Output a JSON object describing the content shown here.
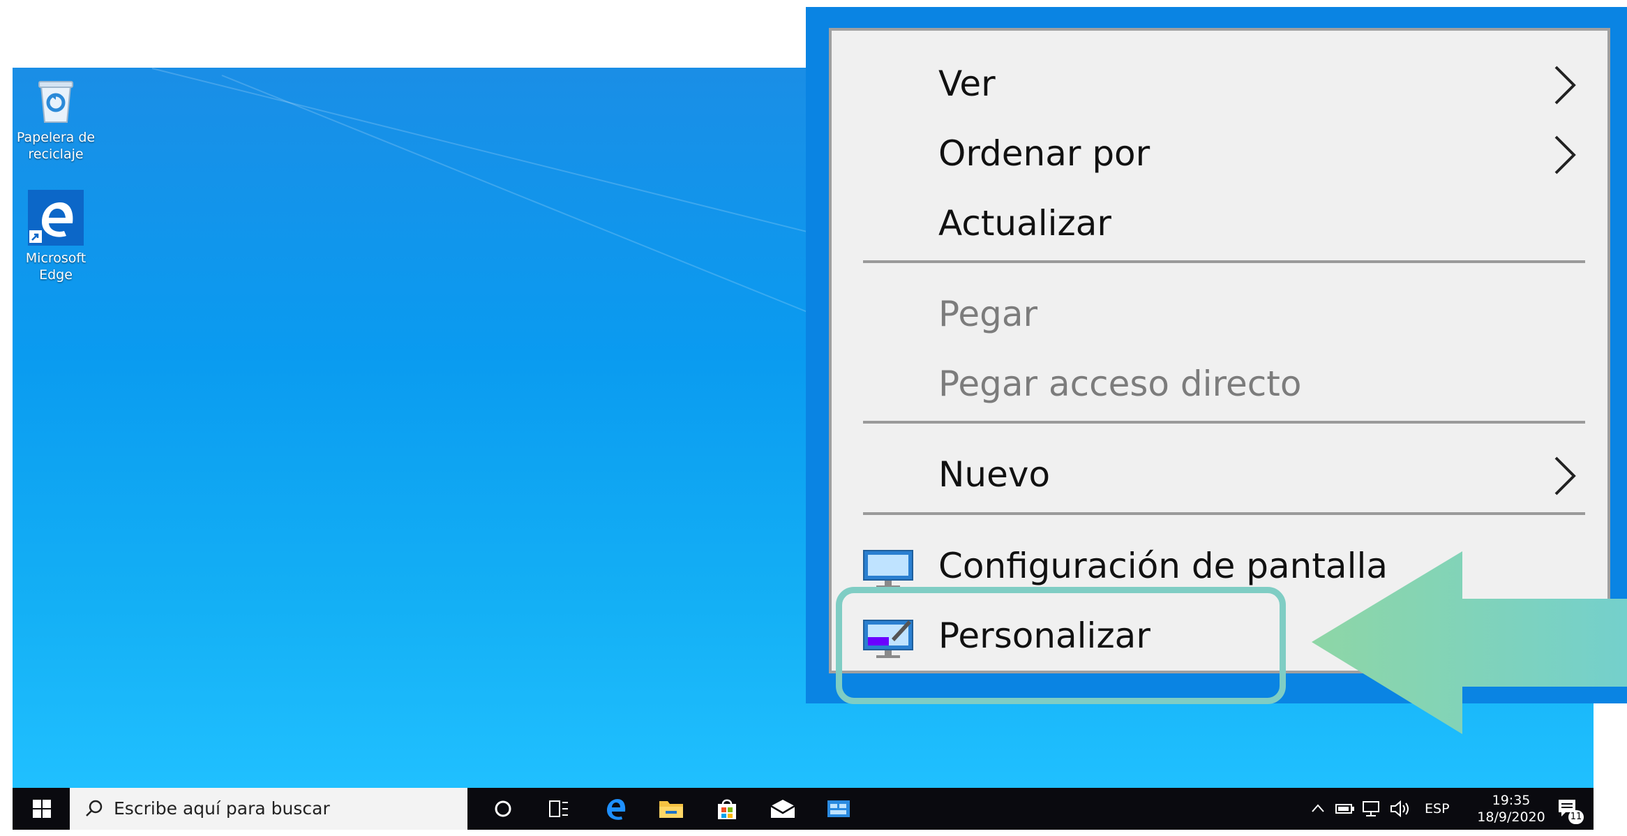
{
  "desktop": {
    "icons": [
      {
        "label": "Papelera de reciclaje",
        "icon": "recycle-bin-icon"
      },
      {
        "label": "Microsoft Edge",
        "icon": "edge-icon"
      }
    ]
  },
  "context_menu": {
    "items": [
      {
        "label": "Ver",
        "submenu": true,
        "enabled": true
      },
      {
        "label": "Ordenar por",
        "submenu": true,
        "enabled": true
      },
      {
        "label": "Actualizar",
        "submenu": false,
        "enabled": true
      },
      {
        "label": "Pegar",
        "submenu": false,
        "enabled": false
      },
      {
        "label": "Pegar acceso directo",
        "submenu": false,
        "enabled": false
      },
      {
        "label": "Nuevo",
        "submenu": true,
        "enabled": true
      },
      {
        "label": "Configuración de pantalla",
        "submenu": false,
        "enabled": true,
        "icon": "display-settings-icon"
      },
      {
        "label": "Personalizar",
        "submenu": false,
        "enabled": true,
        "icon": "personalize-icon",
        "highlighted": true
      }
    ]
  },
  "annotation": {
    "highlight_color": "#7fcdc4",
    "arrow_color": "#7ed0b0"
  },
  "taskbar": {
    "search_placeholder": "Escribe aquí para buscar",
    "language": "ESP",
    "time": "19:35",
    "date": "18/9/2020",
    "notification_count": "11"
  },
  "colors": {
    "desktop": "#0a9bf0",
    "menu_bg": "#f0f0f0",
    "taskbar": "#0a0a0f"
  }
}
